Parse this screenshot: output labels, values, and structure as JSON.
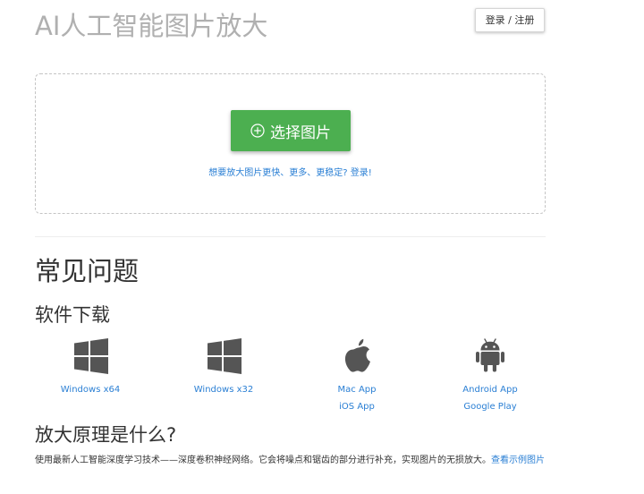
{
  "header": {
    "title": "AI人工智能图片放大",
    "login_label": "登录 / 注册"
  },
  "upload": {
    "select_label": "选择图片",
    "login_hint": "想要放大图片更快、更多、更稳定? 登录!"
  },
  "faq": {
    "title": "常见问题",
    "download_title": "软件下载",
    "downloads": [
      {
        "icon": "windows-icon",
        "links": [
          "Windows x64"
        ]
      },
      {
        "icon": "windows-icon",
        "links": [
          "Windows x32"
        ]
      },
      {
        "icon": "apple-icon",
        "links": [
          "Mac App",
          "iOS App"
        ]
      },
      {
        "icon": "android-icon",
        "links": [
          "Android App",
          "Google Play"
        ]
      }
    ],
    "principle_title": "放大原理是什么?",
    "principle_text": "使用最新人工智能深度学习技术——深度卷积神经网络。它会将噪点和锯齿的部分进行补充，实现图片的无损放大。",
    "principle_link": "查看示例图片"
  },
  "colors": {
    "accent_green": "#4caf50",
    "link_blue": "#2a7fd4",
    "title_gray": "#b0b0b0",
    "icon_gray": "#555555"
  }
}
